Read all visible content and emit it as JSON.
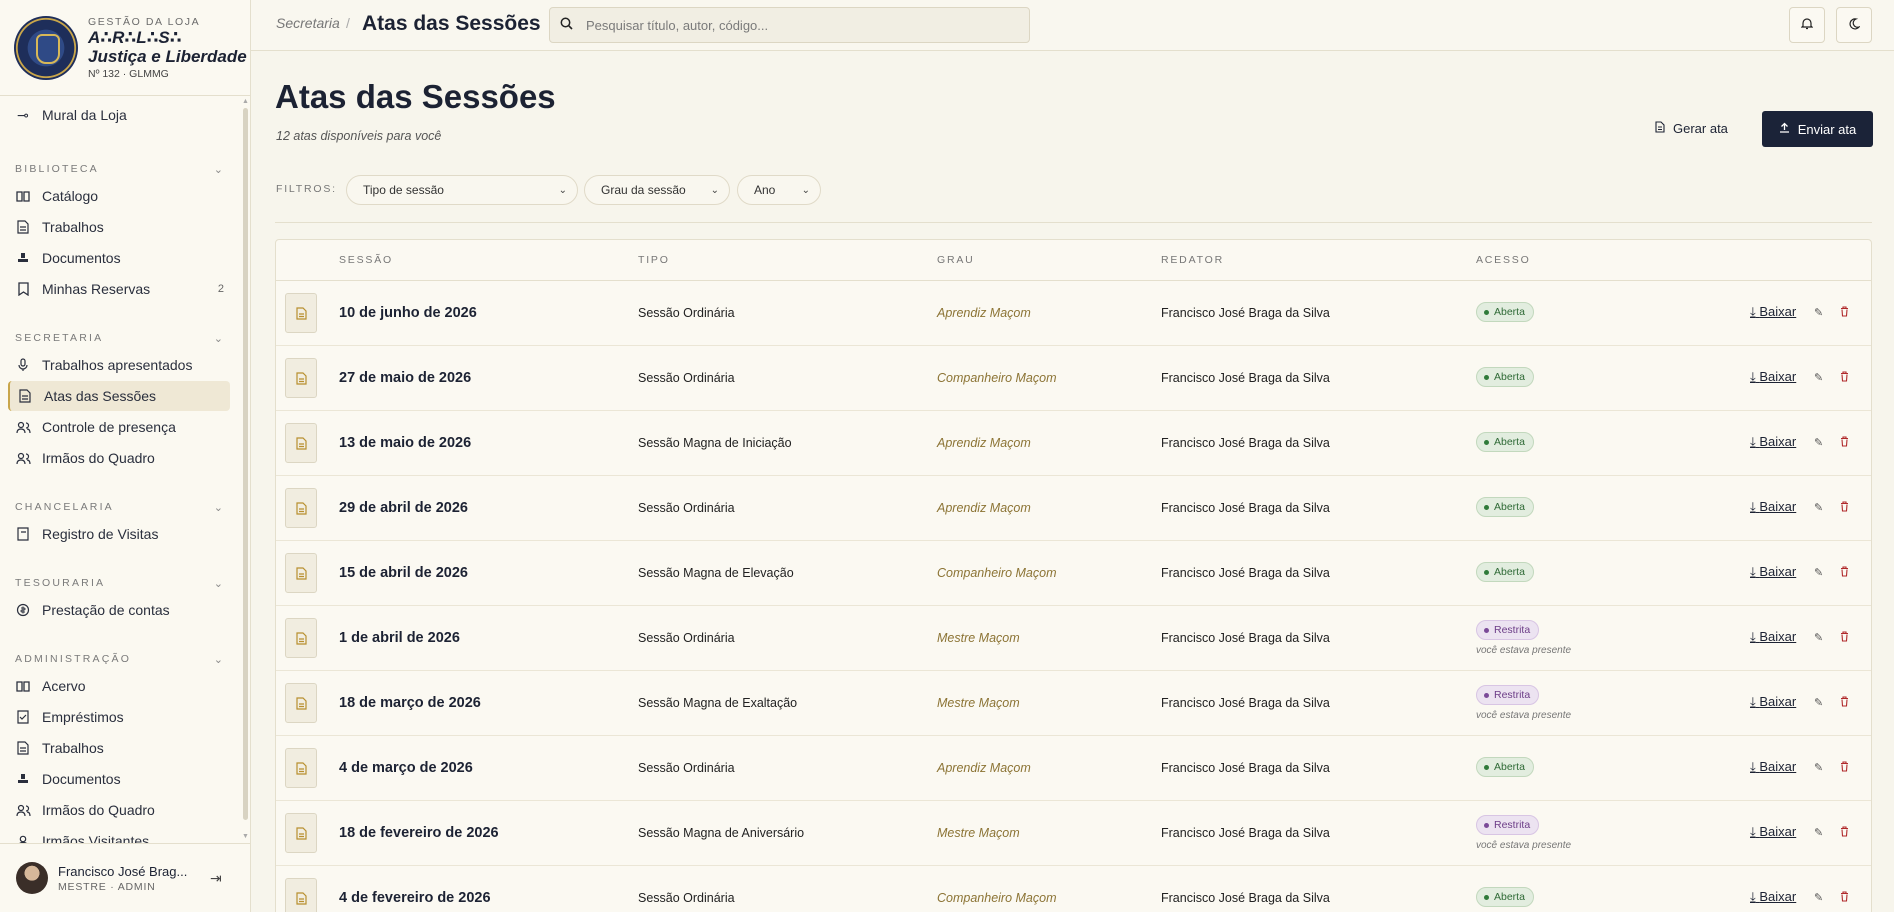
{
  "brand": {
    "kicker": "GESTÃO DA LOJA",
    "name_line1": "A∴R∴L∴S∴",
    "name_line2": "Justiça e Liberdade",
    "sub": "Nº 132 · GLMMG"
  },
  "nav": {
    "top": [
      {
        "label": "Mural da Loja",
        "icon": "pin-icon"
      }
    ],
    "sections": [
      {
        "title": "BIBLIOTECA",
        "items": [
          {
            "label": "Catálogo",
            "icon": "book-icon"
          },
          {
            "label": "Trabalhos",
            "icon": "file-icon"
          },
          {
            "label": "Documentos",
            "icon": "stamp-icon"
          },
          {
            "label": "Minhas Reservas",
            "icon": "bookmark-icon",
            "count": "2"
          }
        ]
      },
      {
        "title": "SECRETARIA",
        "items": [
          {
            "label": "Trabalhos apresentados",
            "icon": "mic-icon"
          },
          {
            "label": "Atas das Sessões",
            "icon": "file-icon",
            "active": true
          },
          {
            "label": "Controle de presença",
            "icon": "users-icon"
          },
          {
            "label": "Irmãos do Quadro",
            "icon": "users-icon"
          }
        ]
      },
      {
        "title": "CHANCELARIA",
        "items": [
          {
            "label": "Registro de Visitas",
            "icon": "register-icon"
          }
        ]
      },
      {
        "title": "TESOURARIA",
        "items": [
          {
            "label": "Prestação de contas",
            "icon": "coin-icon"
          }
        ]
      },
      {
        "title": "ADMINISTRAÇÃO",
        "items": [
          {
            "label": "Acervo",
            "icon": "book-icon"
          },
          {
            "label": "Empréstimos",
            "icon": "checklist-icon"
          },
          {
            "label": "Trabalhos",
            "icon": "file-icon"
          },
          {
            "label": "Documentos",
            "icon": "stamp-icon"
          },
          {
            "label": "Irmãos do Quadro",
            "icon": "users-icon"
          },
          {
            "label": "Irmãos Visitantes",
            "icon": "user-icon"
          }
        ]
      }
    ]
  },
  "user": {
    "name": "Francisco José Brag...",
    "role": "MESTRE · ADMIN"
  },
  "topbar": {
    "crumb_parent": "Secretaria",
    "crumb_sep": "/",
    "crumb_current": "Atas das Sessões",
    "search_placeholder": "Pesquisar título, autor, código..."
  },
  "page": {
    "title": "Atas das Sessões",
    "subtitle": "12 atas disponíveis para você",
    "btn_generate": "Gerar ata",
    "btn_upload": "Enviar ata"
  },
  "filters": {
    "label": "FILTROS:",
    "tipo": "Tipo de sessão",
    "grau": "Grau da sessão",
    "ano": "Ano"
  },
  "table": {
    "headers": {
      "sessao": "SESSÃO",
      "tipo": "TIPO",
      "grau": "GRAU",
      "redator": "REDATOR",
      "acesso": "ACESSO"
    },
    "download_label": "Baixar",
    "rows": [
      {
        "date": "10 de junho de 2026",
        "tipo": "Sessão Ordinária",
        "grau": "Aprendiz Maçom",
        "redator": "Francisco José Braga da Silva",
        "acesso": "Aberta",
        "restricted": false,
        "note": ""
      },
      {
        "date": "27 de maio de 2026",
        "tipo": "Sessão Ordinária",
        "grau": "Companheiro Maçom",
        "redator": "Francisco José Braga da Silva",
        "acesso": "Aberta",
        "restricted": false,
        "note": ""
      },
      {
        "date": "13 de maio de 2026",
        "tipo": "Sessão Magna de Iniciação",
        "grau": "Aprendiz Maçom",
        "redator": "Francisco José Braga da Silva",
        "acesso": "Aberta",
        "restricted": false,
        "note": ""
      },
      {
        "date": "29 de abril de 2026",
        "tipo": "Sessão Ordinária",
        "grau": "Aprendiz Maçom",
        "redator": "Francisco José Braga da Silva",
        "acesso": "Aberta",
        "restricted": false,
        "note": ""
      },
      {
        "date": "15 de abril de 2026",
        "tipo": "Sessão Magna de Elevação",
        "grau": "Companheiro Maçom",
        "redator": "Francisco José Braga da Silva",
        "acesso": "Aberta",
        "restricted": false,
        "note": ""
      },
      {
        "date": "1 de abril de 2026",
        "tipo": "Sessão Ordinária",
        "grau": "Mestre Maçom",
        "redator": "Francisco José Braga da Silva",
        "acesso": "Restrita",
        "restricted": true,
        "note": "você estava presente"
      },
      {
        "date": "18 de março de 2026",
        "tipo": "Sessão Magna de Exaltação",
        "grau": "Mestre Maçom",
        "redator": "Francisco José Braga da Silva",
        "acesso": "Restrita",
        "restricted": true,
        "note": "você estava presente"
      },
      {
        "date": "4 de março de 2026",
        "tipo": "Sessão Ordinária",
        "grau": "Aprendiz Maçom",
        "redator": "Francisco José Braga da Silva",
        "acesso": "Aberta",
        "restricted": false,
        "note": ""
      },
      {
        "date": "18 de fevereiro de 2026",
        "tipo": "Sessão Magna de Aniversário",
        "grau": "Mestre Maçom",
        "redator": "Francisco José Braga da Silva",
        "acesso": "Restrita",
        "restricted": true,
        "note": "você estava presente"
      },
      {
        "date": "4 de fevereiro de 2026",
        "tipo": "Sessão Ordinária",
        "grau": "Companheiro Maçom",
        "redator": "Francisco José Braga da Silva",
        "acesso": "Aberta",
        "restricted": false,
        "note": ""
      }
    ]
  }
}
